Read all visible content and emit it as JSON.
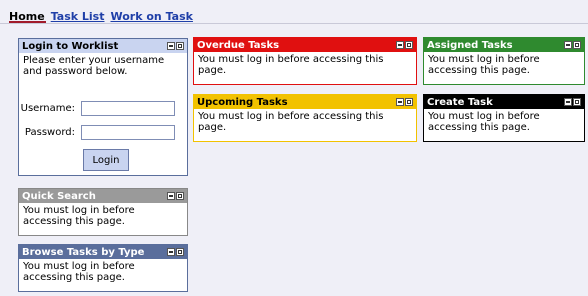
{
  "nav": {
    "home": "Home",
    "task_list": "Task List",
    "work_on_task": "Work on Task"
  },
  "login": {
    "title": "Login to Worklist",
    "instructions": "Please enter your username and password below.",
    "username_label": "Username:",
    "password_label": "Password:",
    "username_value": "",
    "password_value": "",
    "button": "Login"
  },
  "quick_search": {
    "title": "Quick Search",
    "body": "You must log in before accessing this page."
  },
  "browse": {
    "title": "Browse Tasks by Type",
    "body": "You must log in before accessing this page."
  },
  "overdue": {
    "title": "Overdue Tasks",
    "body": "You must log in before accessing this page."
  },
  "upcoming": {
    "title": "Upcoming Tasks",
    "body": "You must log in before accessing this page."
  },
  "assigned": {
    "title": "Assigned Tasks",
    "body": "You must log in before accessing this page."
  },
  "create": {
    "title": "Create Task",
    "body": "You must log in before accessing this page."
  },
  "colors": {
    "login_header": "#c9d4f0",
    "quick_search_header": "#9a9a9a",
    "browse_header": "#5a6e9c",
    "overdue_header": "#e01010",
    "upcoming_header": "#f2c200",
    "assigned_header": "#2f8a2f",
    "create_header": "#000000"
  }
}
